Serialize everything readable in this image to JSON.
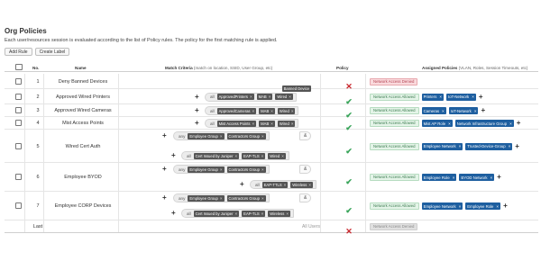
{
  "page": {
    "title": "Org Policies",
    "subtitle": "Each user/resources session is evaluated according to the list of Policy rules. The policy for the first matching rule is applied.",
    "add_rule": "Add Rule",
    "create_label": "Create Label"
  },
  "table": {
    "headers": {
      "no": "No.",
      "name": "Name",
      "match": "Match Criteria",
      "match_sub": "(match on location, SSID, User Group, etc)",
      "policy": "Policy",
      "assigned": "Assigned Policies",
      "assigned_sub": "(VLAN, Roles, Session Timeouts, etc)"
    },
    "rows": [
      {
        "num": "1",
        "name": "Deny Banned Devices",
        "criteria": {
          "single": "Banned Device"
        },
        "policy": "deny",
        "assigned": {
          "deny": "Network Access Denied",
          "tags": []
        }
      },
      {
        "num": "2",
        "name": "Approved Wired Printers",
        "criteria": {
          "logic": "all",
          "tags": [
            "ApprovedPrinters",
            "MAB",
            "Wired"
          ]
        },
        "policy": "allow",
        "assigned": {
          "allow": "Network Access Allowed",
          "tags": [
            "Printers",
            "IoT-Network"
          ]
        }
      },
      {
        "num": "3",
        "name": "Approved Wired Cameras",
        "criteria": {
          "logic": "all",
          "tags": [
            "ApprovedCameras",
            "MAB",
            "Wired"
          ]
        },
        "policy": "allow",
        "assigned": {
          "allow": "Network Access Allowed",
          "tags": [
            "Cameras",
            "IoT-Network"
          ]
        }
      },
      {
        "num": "4",
        "name": "Mist Access Points",
        "criteria": {
          "logic": "all",
          "tags": [
            "Mist Access Points",
            "MAB",
            "Wired"
          ]
        },
        "policy": "allow",
        "assigned": {
          "allow": "Network Access Allowed",
          "tags": [
            "Mist AP Role",
            "Network Infrastructure Group"
          ]
        }
      },
      {
        "num": "5",
        "name": "Wired Cert Auth",
        "criteria": {
          "logic": "any",
          "tags": [
            "Employee Group",
            "Contractors Group"
          ],
          "amp": "&",
          "logic2": "all",
          "tags2": [
            "Cert Issued by Juniper",
            "EAP-TLS",
            "Wired"
          ]
        },
        "policy": "allow",
        "assigned": {
          "allow": "Network Access Allowed",
          "tags": [
            "Employee Network",
            "Trusted-Device-Group"
          ]
        }
      },
      {
        "num": "6",
        "name": "Employee BYOD",
        "criteria": {
          "logic": "any",
          "tags": [
            "Employee Group",
            "Contractors Group"
          ],
          "amp": "&",
          "logic2": "all",
          "tags2": [
            "EAP-TTLS",
            "Wireless"
          ]
        },
        "policy": "allow",
        "assigned": {
          "allow": "Network Access Allowed",
          "tags": [
            "Employee Role",
            "BYOD Network"
          ]
        }
      },
      {
        "num": "7",
        "name": "Employee CORP Devices",
        "criteria": {
          "logic": "any",
          "tags": [
            "Employee Group",
            "Contractors Group"
          ],
          "amp": "&",
          "logic2": "all",
          "tags2": [
            "Cert Issued by Juniper",
            "EAP-TLS",
            "Wireless"
          ]
        },
        "policy": "allow",
        "assigned": {
          "allow": "Network Access Allowed",
          "tags": [
            "Employee Network",
            "Employee Role"
          ]
        }
      }
    ],
    "last": {
      "label": "Last",
      "criteria": "All Users",
      "policy": "deny",
      "assigned": "Network Access Denied"
    }
  }
}
